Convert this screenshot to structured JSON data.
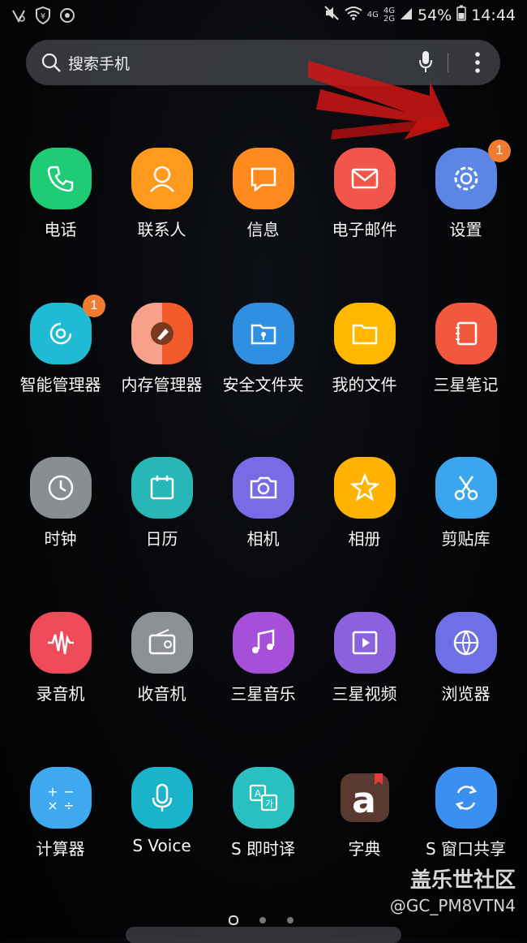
{
  "status": {
    "battery": "54%",
    "time": "14:44",
    "net1": "4G",
    "net2": "4G",
    "net3": "2G"
  },
  "search": {
    "placeholder": "搜索手机"
  },
  "apps": [
    {
      "label": "电话",
      "color": "#1fcb74",
      "badge": ""
    },
    {
      "label": "联系人",
      "color": "#ff9a1f",
      "badge": ""
    },
    {
      "label": "信息",
      "color": "#ff8a1e",
      "badge": ""
    },
    {
      "label": "电子邮件",
      "color": "#f2554a",
      "badge": ""
    },
    {
      "label": "设置",
      "color": "#5b86e6",
      "badge": "1"
    },
    {
      "label": "智能管理器",
      "color": "#1fbbd4",
      "badge": "1"
    },
    {
      "label": "内存管理器",
      "color": "#f26a3a",
      "badge": ""
    },
    {
      "label": "安全文件夹",
      "color": "#2f8fe0",
      "badge": ""
    },
    {
      "label": "我的文件",
      "color": "#ffb800",
      "badge": ""
    },
    {
      "label": "三星笔记",
      "color": "#f2583d",
      "badge": ""
    },
    {
      "label": "时钟",
      "color": "#8a8d92",
      "badge": ""
    },
    {
      "label": "日历",
      "color": "#29b6b6",
      "badge": ""
    },
    {
      "label": "相机",
      "color": "#7a6ae6",
      "badge": ""
    },
    {
      "label": "相册",
      "color": "#ffb300",
      "badge": ""
    },
    {
      "label": "剪贴库",
      "color": "#3aa6ef",
      "badge": ""
    },
    {
      "label": "录音机",
      "color": "#ef4a5a",
      "badge": ""
    },
    {
      "label": "收音机",
      "color": "#8d9094",
      "badge": ""
    },
    {
      "label": "三星音乐",
      "color": "#a64fd9",
      "badge": ""
    },
    {
      "label": "三星视频",
      "color": "#8a62e0",
      "badge": ""
    },
    {
      "label": "浏览器",
      "color": "#6d70e6",
      "badge": ""
    },
    {
      "label": "计算器",
      "color": "#3fa9ef",
      "badge": ""
    },
    {
      "label": "S Voice",
      "color": "#1ab3c9",
      "badge": ""
    },
    {
      "label": "S 即时译",
      "color": "#2ac0c0",
      "badge": ""
    },
    {
      "label": "字典",
      "color": "#5a3a30",
      "badge": ""
    },
    {
      "label": "S 窗口共享",
      "color": "#3a8ff0",
      "badge": ""
    }
  ],
  "watermark": {
    "line1": "盖乐世社区",
    "line2": "@GC_PM8VTN4"
  }
}
